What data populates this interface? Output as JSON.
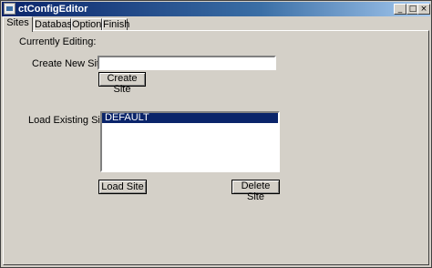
{
  "window": {
    "title": "ctConfigEditor"
  },
  "caption_buttons": {
    "minimize": "_",
    "maximize": "□",
    "close": "×"
  },
  "tabs": [
    {
      "label": "Sites"
    },
    {
      "label": "Database"
    },
    {
      "label": "Options"
    },
    {
      "label": "Finish"
    }
  ],
  "sites": {
    "currently_editing_label": "Currently Editing:",
    "create_label": "Create New Site ID",
    "create_value": "",
    "create_button": "Create Site",
    "load_label": "Load Existing Site ID",
    "site_list": [
      "DEFAULT"
    ],
    "load_button": "Load Site",
    "delete_button": "Delete Site"
  }
}
